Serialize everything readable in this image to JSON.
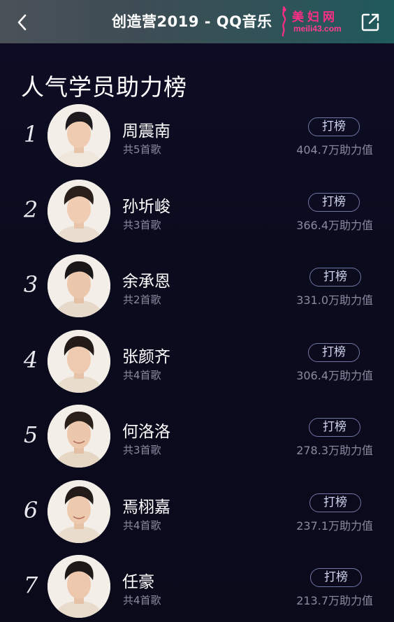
{
  "header": {
    "title": "创造营2019 - QQ音乐",
    "back_icon": "chevron-left-icon",
    "share_icon": "share-external-icon",
    "watermark_cn": "美妇网",
    "watermark_url": "meili43.com"
  },
  "section": {
    "title": "人气学员助力榜"
  },
  "vote_label": "打榜",
  "colors": {
    "background": "#0b0b1e",
    "header_from": "#4a5159",
    "header_to": "#1f5a5c",
    "button_border": "#6f76a3",
    "muted_text": "#8a8aa0",
    "watermark": "#ff2d86"
  },
  "trainees": [
    {
      "rank": "1",
      "name": "周震南",
      "songs": "共5首歌",
      "votes": "404.7万助力值"
    },
    {
      "rank": "2",
      "name": "孙圻峻",
      "songs": "共3首歌",
      "votes": "366.4万助力值"
    },
    {
      "rank": "3",
      "name": "余承恩",
      "songs": "共2首歌",
      "votes": "331.0万助力值"
    },
    {
      "rank": "4",
      "name": "张颜齐",
      "songs": "共4首歌",
      "votes": "306.4万助力值"
    },
    {
      "rank": "5",
      "name": "何洛洛",
      "songs": "共3首歌",
      "votes": "278.3万助力值"
    },
    {
      "rank": "6",
      "name": "焉栩嘉",
      "songs": "共4首歌",
      "votes": "237.1万助力值"
    },
    {
      "rank": "7",
      "name": "任豪",
      "songs": "共4首歌",
      "votes": "213.7万助力值"
    }
  ]
}
